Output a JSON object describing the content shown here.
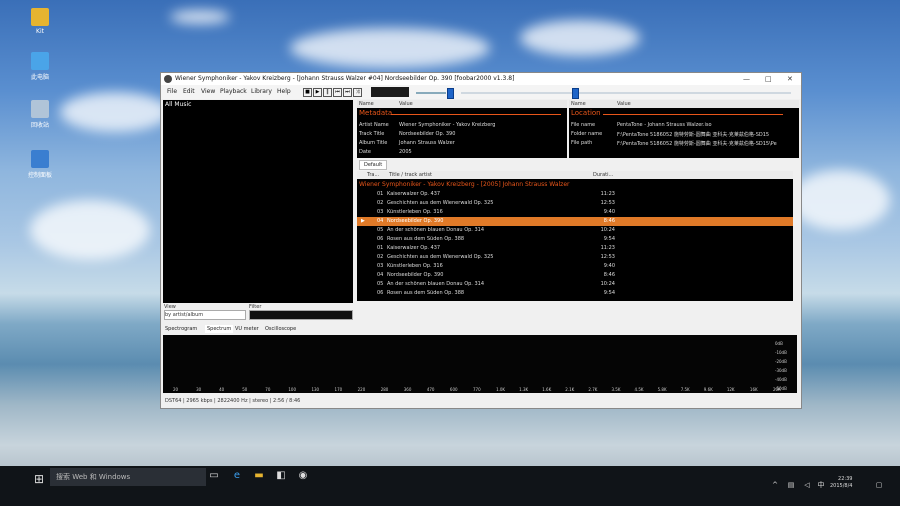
{
  "desktop": {
    "icons": [
      {
        "label": "Kit",
        "color": "#e6b430"
      },
      {
        "label": "此电脑",
        "color": "#4aa4e8"
      },
      {
        "label": "回收站",
        "color": "#b0c4d8"
      },
      {
        "label": "控制面板",
        "color": "#3a7ed0"
      }
    ]
  },
  "window": {
    "title": "Wiener Symphoniker - Yakov Kreizberg - [Johann Strauss Walzer #04] Nordseebilder Op. 390   [foobar2000 v1.3.8]",
    "controls": {
      "minimize": "—",
      "maximize": "□",
      "close": "✕"
    },
    "menu": [
      "File",
      "Edit",
      "View",
      "Playback",
      "Library",
      "Help"
    ],
    "library": {
      "title": "All Music",
      "view_label": "View",
      "view_value": "by artist/album",
      "filter_label": "Filter"
    },
    "properties": {
      "col_name": "Name",
      "col_value": "Value",
      "metadata_title": "Metadata",
      "metadata": [
        {
          "name": "Artist Name",
          "value": "Wiener Symphoniker - Yakov Kreizberg"
        },
        {
          "name": "Track Title",
          "value": "Nordseebilder Op. 390"
        },
        {
          "name": "Album Title",
          "value": "Johann Strauss Walzer"
        },
        {
          "name": "Date",
          "value": "2005"
        }
      ],
      "location_title": "Location",
      "location": [
        {
          "name": "File name",
          "value": "PentaTone - Johann Strauss Walzer.iso"
        },
        {
          "name": "Folder name",
          "value": "F:\\PentaTone 5186052 施特劳斯-圆舞曲 亚科夫·克莱兹伯格-SD15"
        },
        {
          "name": "File path",
          "value": "F:\\PentaTone 5186052 施特劳斯-圆舞曲 亚科夫·克莱兹伯格-SD15\\Pe"
        }
      ]
    },
    "playlist": {
      "tab": "Default",
      "col_track": "Tra...",
      "col_title": "Title / track artist",
      "col_duration": "Durati...",
      "group_header": "Wiener Symphoniker - Yakov Kreizberg - [2005] Johann Strauss Walzer",
      "selected_index": 3,
      "rows": [
        {
          "num": "01",
          "title": "Kaiserwalzer Op. 437",
          "duration": "11:23"
        },
        {
          "num": "02",
          "title": "Geschichten aus dem Wienerwald Op. 325",
          "duration": "12:53"
        },
        {
          "num": "03",
          "title": "Künstlerleben Op. 316",
          "duration": "9:40"
        },
        {
          "num": "04",
          "title": "Nordseebilder Op. 390",
          "duration": "8:46"
        },
        {
          "num": "05",
          "title": "An der schönen blauen Donau Op. 314",
          "duration": "10:24"
        },
        {
          "num": "06",
          "title": "Rosen aus dem Süden Op. 388",
          "duration": "9:54"
        },
        {
          "num": "01",
          "title": "Kaiserwalzer Op. 437",
          "duration": "11:23"
        },
        {
          "num": "02",
          "title": "Geschichten aus dem Wienerwald Op. 325",
          "duration": "12:53"
        },
        {
          "num": "03",
          "title": "Künstlerleben Op. 316",
          "duration": "9:40"
        },
        {
          "num": "04",
          "title": "Nordseebilder Op. 390",
          "duration": "8:46"
        },
        {
          "num": "05",
          "title": "An der schönen blauen Donau Op. 314",
          "duration": "10:24"
        },
        {
          "num": "06",
          "title": "Rosen aus dem Süden Op. 388",
          "duration": "9:54"
        }
      ]
    },
    "visualizer": {
      "tabs": [
        "Spectrogram",
        "Spectrum",
        "VU meter",
        "Oscilloscope"
      ],
      "active_tab": "Spectrum",
      "freq_ticks": [
        "20",
        "30",
        "40",
        "50",
        "70",
        "100",
        "130",
        "170",
        "220",
        "280",
        "360",
        "470",
        "600",
        "770",
        "1.0K",
        "1.3K",
        "1.6K",
        "2.1K",
        "2.7K",
        "3.5K",
        "4.5K",
        "5.8K",
        "7.5K",
        "9.6K",
        "12K",
        "16K",
        "20K"
      ],
      "db_ticks": [
        "0dB",
        "-10dB",
        "-20dB",
        "-30dB",
        "-40dB",
        "-50dB"
      ]
    },
    "status": "DST64 | 2965 kbps | 2822400 Hz | stereo | 2:56 / 8:46"
  },
  "taskbar": {
    "search_placeholder": "搜索 Web 和 Windows",
    "time": "22:39",
    "date": "2015/8/4"
  },
  "colors": {
    "accent": "#e8561a",
    "selection": "#e07a28"
  }
}
